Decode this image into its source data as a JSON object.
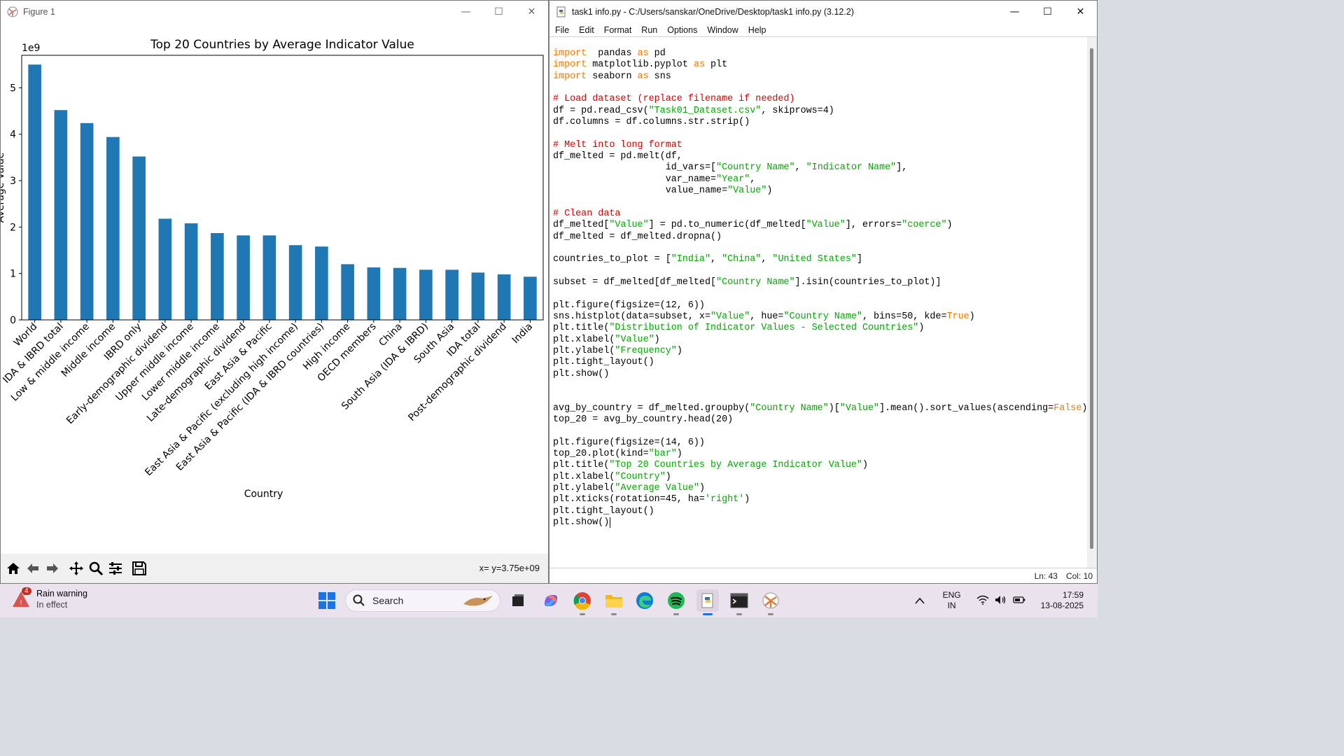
{
  "figure_window": {
    "title": "Figure 1",
    "controls": [
      "—",
      "☐",
      "✕"
    ],
    "coord_readout": "x= y=3.75e+09",
    "toolbar_icons": [
      "home-icon",
      "back-arrow-icon",
      "forward-arrow-icon",
      "pan-icon",
      "zoom-icon",
      "configure-subplots-icon",
      "save-icon"
    ]
  },
  "chart_data": {
    "type": "bar",
    "title": "Top 20 Countries by Average Indicator Value",
    "xlabel": "Country",
    "ylabel": "Average Value",
    "offset_text": "1e9",
    "categories": [
      "World",
      "IDA & IBRD total",
      "Low & middle income",
      "Middle income",
      "IBRD only",
      "Early-demographic dividend",
      "Upper middle income",
      "Lower middle income",
      "Late-demographic dividend",
      "East Asia & Pacific",
      "East Asia & Pacific (excluding high income)",
      "East Asia & Pacific (IDA & IBRD countries)",
      "High income",
      "OECD members",
      "China",
      "South Asia (IDA & IBRD)",
      "South Asia",
      "IDA total",
      "Post-demographic dividend",
      "India"
    ],
    "values": [
      5.5,
      4.52,
      4.24,
      3.94,
      3.52,
      2.18,
      2.08,
      1.87,
      1.82,
      1.82,
      1.61,
      1.58,
      1.2,
      1.13,
      1.12,
      1.08,
      1.08,
      1.02,
      0.98,
      0.93
    ],
    "ylim": [
      0,
      5.7
    ],
    "yticks": [
      0,
      1,
      2,
      3,
      4,
      5
    ],
    "bar_color": "#1f77b4",
    "grid": false
  },
  "idle_window": {
    "title": "task1 info.py - C:/Users/sanskar/OneDrive/Desktop/task1 info.py (3.12.2)",
    "controls": [
      "—",
      "☐",
      "✕"
    ],
    "menu": [
      "File",
      "Edit",
      "Format",
      "Run",
      "Options",
      "Window",
      "Help"
    ],
    "status": {
      "line": "Ln: 43",
      "col": "Col: 10"
    },
    "code": [
      [
        [
          "kw",
          "import"
        ],
        [
          "",
          "  pandas "
        ],
        [
          "kw",
          "as"
        ],
        [
          "",
          " pd"
        ]
      ],
      [
        [
          "kw",
          "import"
        ],
        [
          "",
          " matplotlib.pyplot "
        ],
        [
          "kw",
          "as"
        ],
        [
          "",
          " plt"
        ]
      ],
      [
        [
          "kw",
          "import"
        ],
        [
          "",
          " seaborn "
        ],
        [
          "kw",
          "as"
        ],
        [
          "",
          " sns"
        ]
      ],
      [],
      [
        [
          "cm",
          "# Load dataset (replace filename if needed)"
        ]
      ],
      [
        [
          "",
          "df = pd.read_csv("
        ],
        [
          "str",
          "\"Task01_Dataset.csv\""
        ],
        [
          "",
          ", skiprows=4)"
        ]
      ],
      [
        [
          "",
          "df.columns = df.columns.str.strip()"
        ]
      ],
      [],
      [
        [
          "cm",
          "# Melt into long format"
        ]
      ],
      [
        [
          "",
          "df_melted = pd.melt(df,"
        ]
      ],
      [
        [
          "",
          "                    id_vars=["
        ],
        [
          "str",
          "\"Country Name\""
        ],
        [
          "",
          ", "
        ],
        [
          "str",
          "\"Indicator Name\""
        ],
        [
          "",
          "],"
        ]
      ],
      [
        [
          "",
          "                    var_name="
        ],
        [
          "str",
          "\"Year\""
        ],
        [
          "",
          ","
        ]
      ],
      [
        [
          "",
          "                    value_name="
        ],
        [
          "str",
          "\"Value\""
        ],
        [
          "",
          ")"
        ]
      ],
      [],
      [
        [
          "cm",
          "# Clean data"
        ]
      ],
      [
        [
          "",
          "df_melted["
        ],
        [
          "str",
          "\"Value\""
        ],
        [
          "",
          "] = pd.to_numeric(df_melted["
        ],
        [
          "str",
          "\"Value\""
        ],
        [
          "",
          "], errors="
        ],
        [
          "str",
          "\"coerce\""
        ],
        [
          "",
          ")"
        ]
      ],
      [
        [
          "",
          "df_melted = df_melted.dropna()"
        ]
      ],
      [],
      [
        [
          "",
          "countries_to_plot = ["
        ],
        [
          "str",
          "\"India\""
        ],
        [
          "",
          ", "
        ],
        [
          "str",
          "\"China\""
        ],
        [
          "",
          ", "
        ],
        [
          "str",
          "\"United States\""
        ],
        [
          "",
          "]"
        ]
      ],
      [],
      [
        [
          "",
          "subset = df_melted[df_melted["
        ],
        [
          "str",
          "\"Country Name\""
        ],
        [
          "",
          "].isin(countries_to_plot)]"
        ]
      ],
      [],
      [
        [
          "",
          "plt.figure(figsize=(12, 6))"
        ]
      ],
      [
        [
          "",
          "sns.histplot(data=subset, x="
        ],
        [
          "str",
          "\"Value\""
        ],
        [
          "",
          ", hue="
        ],
        [
          "str",
          "\"Country Name\""
        ],
        [
          "",
          ", bins=50, kde="
        ],
        [
          "kw",
          "True"
        ],
        [
          "",
          ")"
        ]
      ],
      [
        [
          "",
          "plt.title("
        ],
        [
          "str",
          "\"Distribution of Indicator Values - Selected Countries\""
        ],
        [
          "",
          ")"
        ]
      ],
      [
        [
          "",
          "plt.xlabel("
        ],
        [
          "str",
          "\"Value\""
        ],
        [
          "",
          ")"
        ]
      ],
      [
        [
          "",
          "plt.ylabel("
        ],
        [
          "str",
          "\"Frequency\""
        ],
        [
          "",
          ")"
        ]
      ],
      [
        [
          "",
          "plt.tight_layout()"
        ]
      ],
      [
        [
          "",
          "plt.show()"
        ]
      ],
      [],
      [],
      [
        [
          "",
          "avg_by_country = df_melted.groupby("
        ],
        [
          "str",
          "\"Country Name\""
        ],
        [
          "",
          ")["
        ],
        [
          "str",
          "\"Value\""
        ],
        [
          "",
          "].mean().sort_values(ascending="
        ],
        [
          "kw",
          "False"
        ],
        [
          "",
          ")"
        ]
      ],
      [
        [
          "",
          "top_20 = avg_by_country.head(20)"
        ]
      ],
      [],
      [
        [
          "",
          "plt.figure(figsize=(14, 6))"
        ]
      ],
      [
        [
          "",
          "top_20.plot(kind="
        ],
        [
          "str",
          "\"bar\""
        ],
        [
          "",
          ")"
        ]
      ],
      [
        [
          "",
          "plt.title("
        ],
        [
          "str",
          "\"Top 20 Countries by Average Indicator Value\""
        ],
        [
          "",
          ")"
        ]
      ],
      [
        [
          "",
          "plt.xlabel("
        ],
        [
          "str",
          "\"Country\""
        ],
        [
          "",
          ")"
        ]
      ],
      [
        [
          "",
          "plt.ylabel("
        ],
        [
          "str",
          "\"Average Value\""
        ],
        [
          "",
          ")"
        ]
      ],
      [
        [
          "",
          "plt.xticks(rotation=45, ha="
        ],
        [
          "str",
          "'right'"
        ],
        [
          "",
          ")"
        ]
      ],
      [
        [
          "",
          "plt.tight_layout()"
        ]
      ],
      [
        [
          "",
          "plt.show()"
        ]
      ]
    ]
  },
  "taskbar": {
    "weather_title": "Rain warning",
    "weather_sub": "In effect",
    "weather_badge": "4",
    "search_placeholder": "Search",
    "lang_line1": "ENG",
    "lang_line2": "IN",
    "time": "17:59",
    "date": "13-08-2025"
  }
}
